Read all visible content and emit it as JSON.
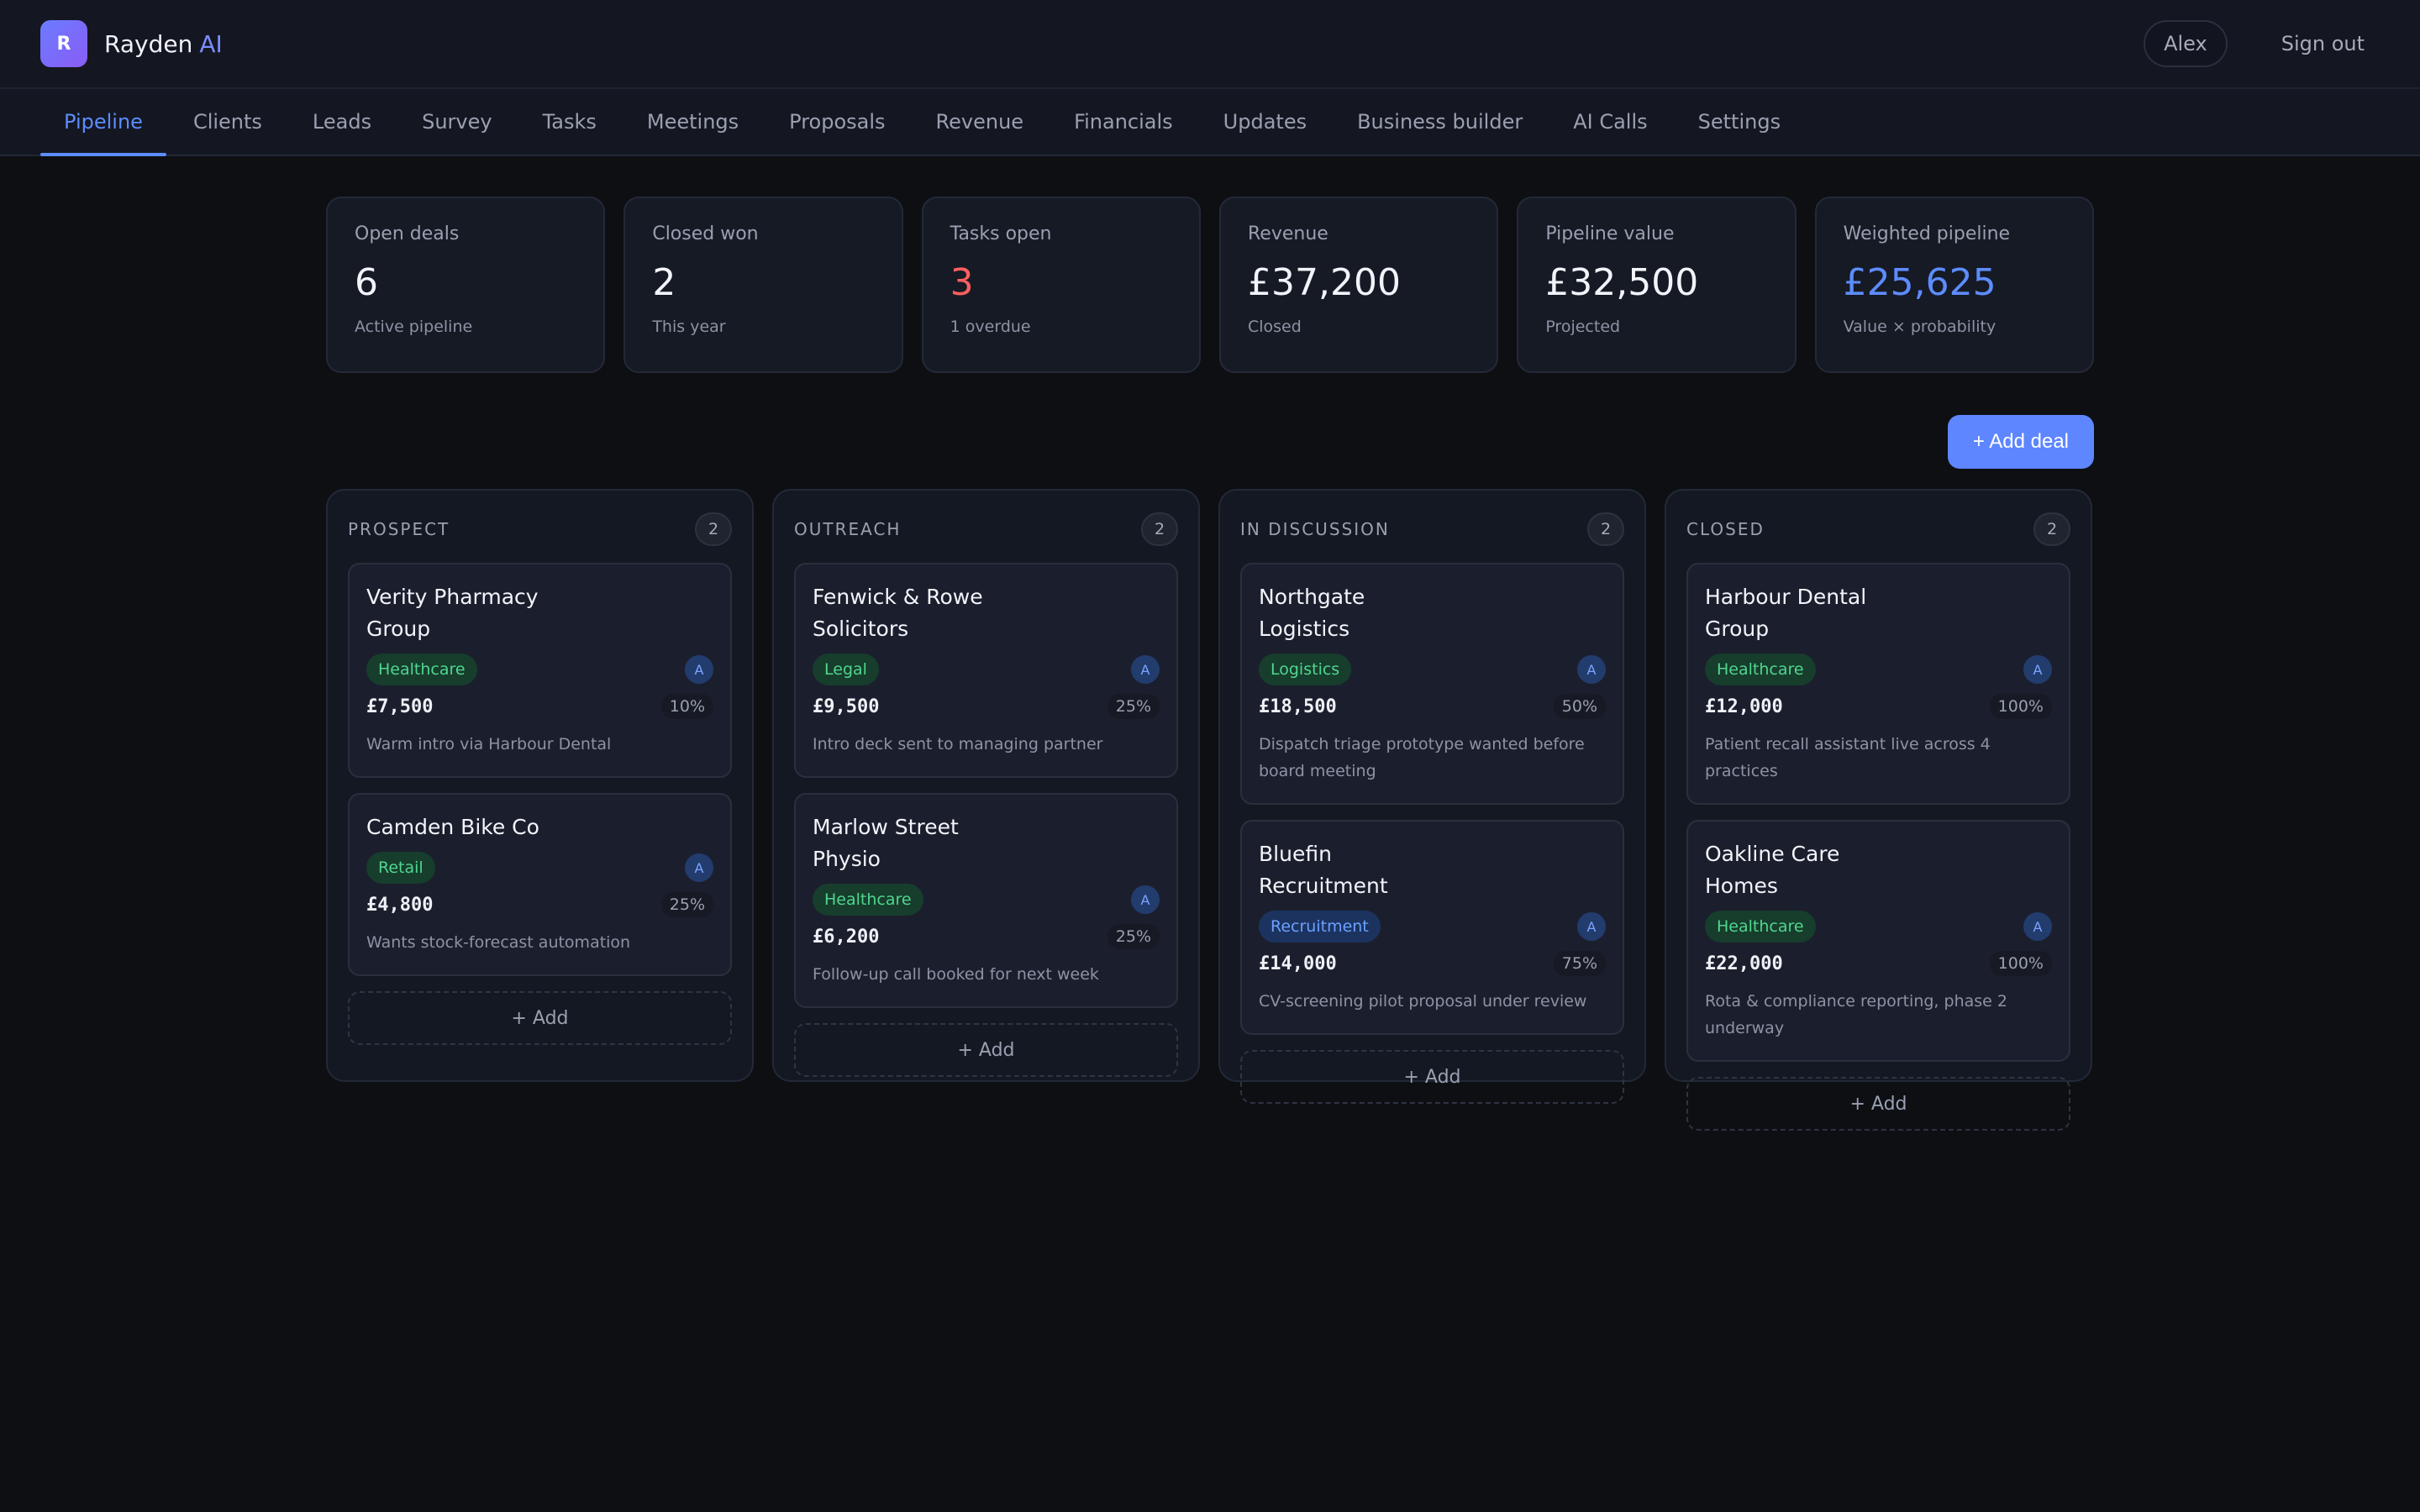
{
  "app": {
    "logo_letter": "R",
    "name": "Rayden",
    "name_accent": "AI"
  },
  "header": {
    "user": "Alex",
    "signout": "Sign out"
  },
  "nav": {
    "tabs": [
      {
        "label": "Pipeline",
        "active": true
      },
      {
        "label": "Clients"
      },
      {
        "label": "Leads"
      },
      {
        "label": "Survey"
      },
      {
        "label": "Tasks"
      },
      {
        "label": "Meetings"
      },
      {
        "label": "Proposals"
      },
      {
        "label": "Revenue"
      },
      {
        "label": "Financials"
      },
      {
        "label": "Updates"
      },
      {
        "label": "Business builder"
      },
      {
        "label": "AI Calls"
      },
      {
        "label": "Settings"
      }
    ]
  },
  "stats": [
    {
      "label": "Open deals",
      "value": "6",
      "sub": "Active pipeline"
    },
    {
      "label": "Closed won",
      "value": "2",
      "sub": "This year"
    },
    {
      "label": "Tasks open",
      "value": "3",
      "sub": "1 overdue"
    },
    {
      "label": "Revenue",
      "value": "£37,200",
      "sub": "Closed"
    },
    {
      "label": "Pipeline value",
      "value": "£32,500",
      "sub": "Projected"
    },
    {
      "label": "Weighted pipeline",
      "value": "£25,625",
      "sub": "Value × probability"
    }
  ],
  "actions": {
    "add_deal": "+ Add deal"
  },
  "board": {
    "add_label": "+ Add",
    "columns": [
      {
        "title": "PROSPECT",
        "count": "2",
        "cards": [
          {
            "title": "Verity Pharmacy Group",
            "tag": "Healthcare",
            "avatar": "A",
            "amount": "£7,500",
            "pct": "10%",
            "note": "Warm intro via Harbour Dental"
          },
          {
            "title": "Camden Bike Co",
            "tag": "Retail",
            "avatar": "A",
            "amount": "£4,800",
            "pct": "25%",
            "note": "Wants stock-forecast automation"
          }
        ]
      },
      {
        "title": "OUTREACH",
        "count": "2",
        "cards": [
          {
            "title": "Fenwick & Rowe Solicitors",
            "tag": "Legal",
            "avatar": "A",
            "amount": "£9,500",
            "pct": "25%",
            "note": "Intro deck sent to managing partner"
          },
          {
            "title": "Marlow Street Physio",
            "tag": "Healthcare",
            "avatar": "A",
            "amount": "£6,200",
            "pct": "25%",
            "note": "Follow-up call booked for next week"
          }
        ]
      },
      {
        "title": "IN DISCUSSION",
        "count": "2",
        "cards": [
          {
            "title": "Northgate Logistics",
            "tag": "Logistics",
            "avatar": "A",
            "amount": "£18,500",
            "pct": "50%",
            "note": "Dispatch triage prototype wanted before board meeting"
          },
          {
            "title": "Bluefin Recruitment",
            "tag": "Recruitment",
            "avatar": "A",
            "amount": "£14,000",
            "pct": "75%",
            "note": "CV-screening pilot proposal under review"
          }
        ]
      },
      {
        "title": "CLOSED",
        "count": "2",
        "cards": [
          {
            "title": "Harbour Dental Group",
            "tag": "Healthcare",
            "avatar": "A",
            "amount": "£12,000",
            "pct": "100%",
            "note": "Patient recall assistant live across 4 practices"
          },
          {
            "title": "Oakline Care Homes",
            "tag": "Healthcare",
            "avatar": "A",
            "amount": "£22,000",
            "pct": "100%",
            "note": "Rota & compliance reporting, phase 2 underway"
          }
        ]
      }
    ]
  }
}
